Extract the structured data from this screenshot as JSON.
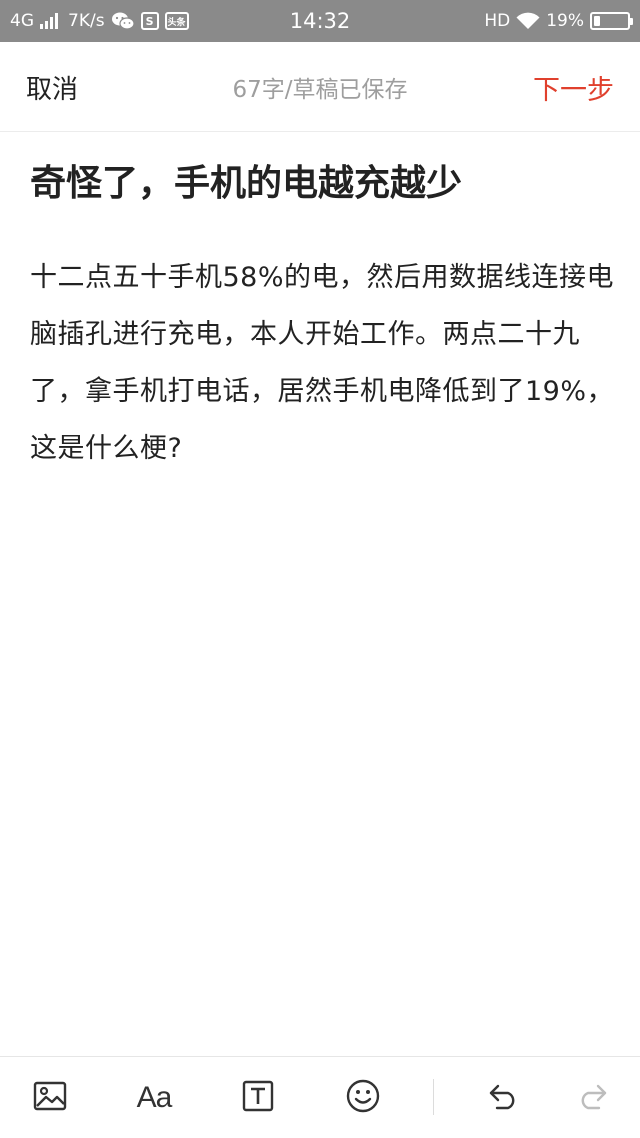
{
  "status_bar": {
    "network": "4G",
    "speed": "7K/s",
    "time": "14:32",
    "hd": "HD",
    "battery_percent": "19%",
    "battery_level": 0.19,
    "app_icon_s": "S",
    "app_icon_toutiao": "头条",
    "icons": [
      "signal-icon",
      "wechat-icon",
      "wifi-icon",
      "battery-icon"
    ]
  },
  "header": {
    "cancel_label": "取消",
    "draft_status": "67字/草稿已保存",
    "next_label": "下一步",
    "accent_color": "#e0402d"
  },
  "editor": {
    "title": "奇怪了，手机的电越充越少",
    "body": "十二点五十手机58%的电，然后用数据线连接电脑插孔进行充电，本人开始工作。两点二十九了，拿手机打电话，居然手机电降低到了19%，这是什么梗?"
  },
  "toolbar": {
    "items": [
      "image-icon",
      "font-icon",
      "text-box-icon",
      "emoji-icon",
      "undo-icon",
      "redo-icon"
    ],
    "font_glyph": "Aa",
    "redo_enabled": false
  }
}
